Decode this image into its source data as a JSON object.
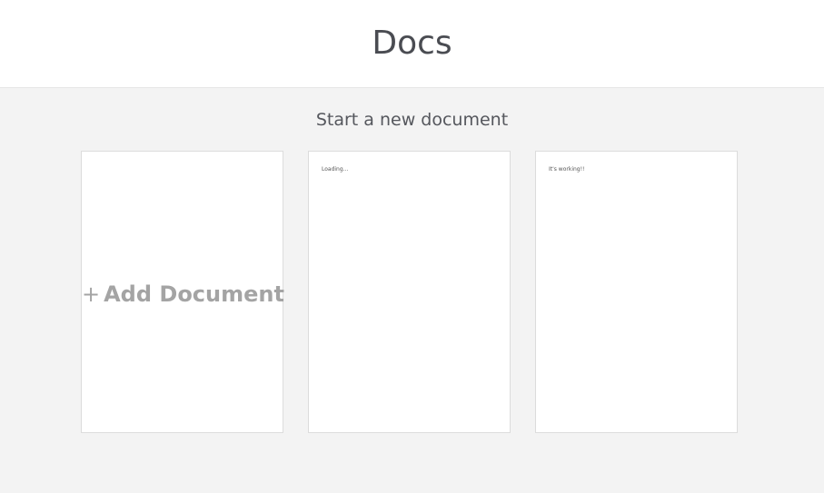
{
  "header": {
    "title": "Docs"
  },
  "main": {
    "section_title": "Start a new document",
    "add_card": {
      "plus": "+",
      "label": "Add Document"
    },
    "documents": [
      {
        "preview_text": "Loading..."
      },
      {
        "preview_text": "It's working!!"
      }
    ]
  },
  "colors": {
    "page_background": "#f3f3f3",
    "header_background": "#ffffff",
    "title_text": "#4a4c52",
    "add_label": "#a4a4a4",
    "card_border": "#dcdcdc"
  }
}
